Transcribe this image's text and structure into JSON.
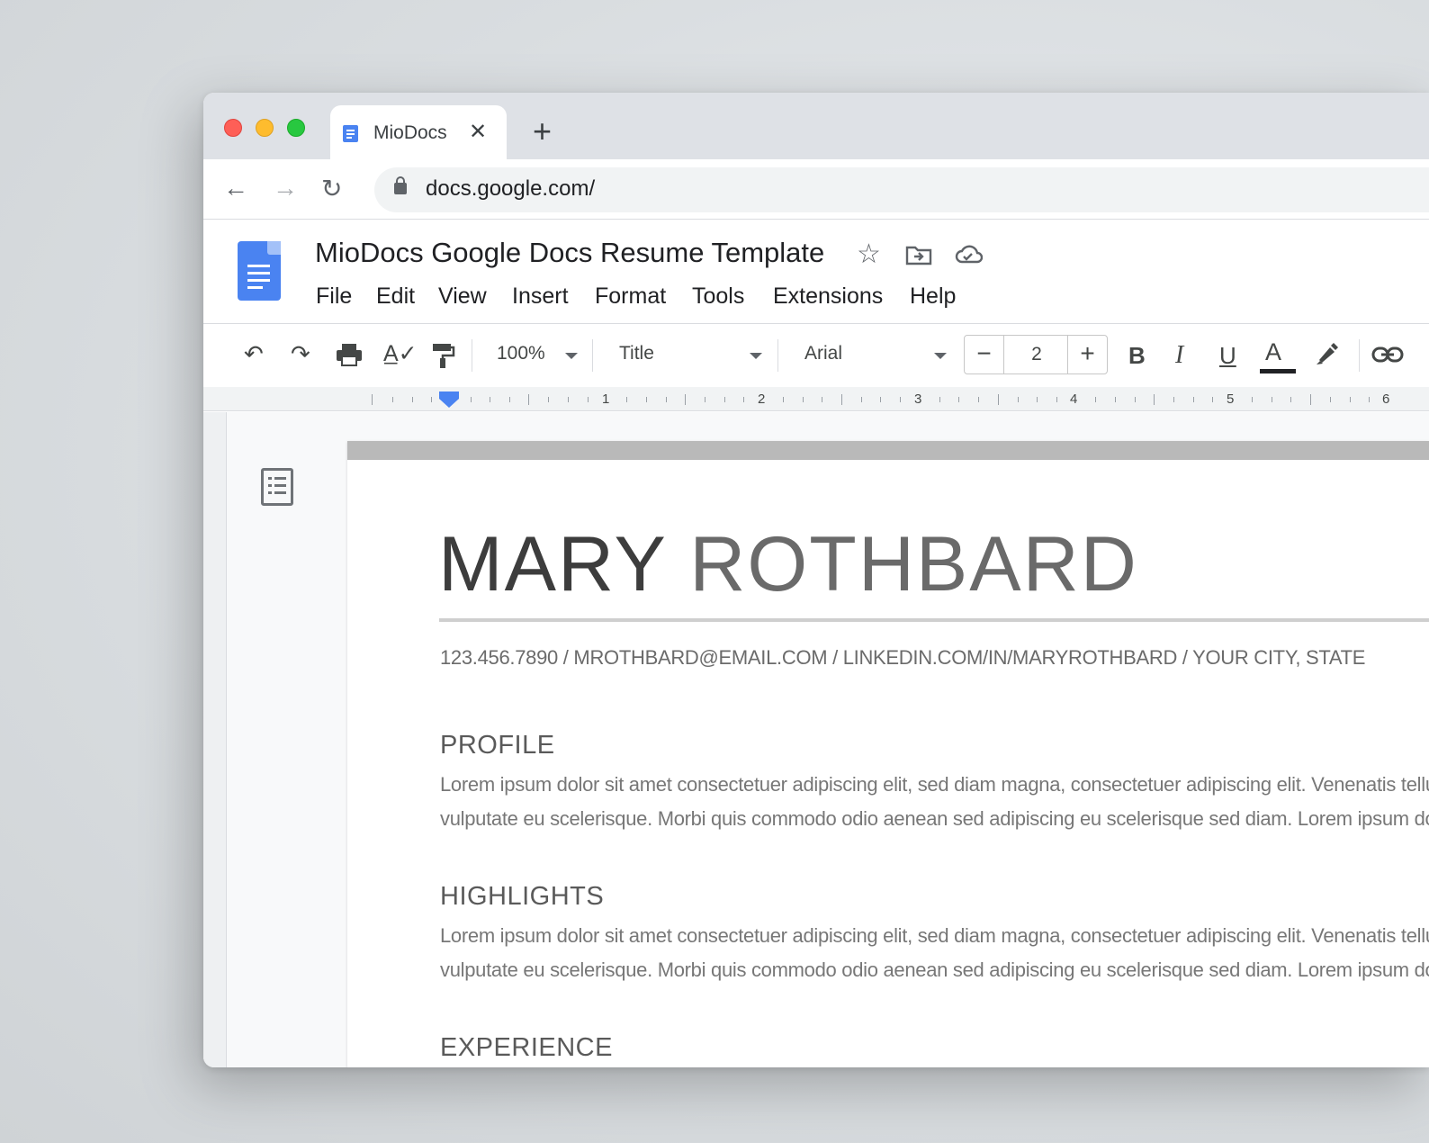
{
  "browser": {
    "tab_title": "MioDocs",
    "new_tab_label": "+",
    "url": "docs.google.com/"
  },
  "docs": {
    "title": "MioDocs Google Docs Resume Template",
    "menu": [
      "File",
      "Edit",
      "View",
      "Insert",
      "Format",
      "Tools",
      "Extensions",
      "Help"
    ],
    "toolbar": {
      "zoom": "100%",
      "style": "Title",
      "font": "Arial",
      "font_size": "2",
      "bold_label": "B",
      "italic_label": "I",
      "underline_label": "U",
      "text_color_label": "A",
      "text_color": "#202124"
    },
    "ruler_numbers": [
      "1",
      "2",
      "3",
      "4",
      "5",
      "6"
    ]
  },
  "resume": {
    "first_name": "MARY",
    "last_name": "ROTHBARD",
    "contact": "123.456.7890  /  MROTHBARD@EMAIL.COM  /  LINKEDIN.COM/IN/MARYROTHBARD  /  YOUR CITY, STATE",
    "sections": [
      {
        "heading": "PROFILE",
        "lines": [
          "Lorem ipsum dolor sit amet consectetuer adipiscing elit, sed diam magna, consectetuer adipiscing elit. Venenatis tellus",
          "vulputate eu scelerisque. Morbi quis commodo odio aenean sed adipiscing eu scelerisque sed diam. Lorem ipsum dolo"
        ]
      },
      {
        "heading": "HIGHLIGHTS",
        "lines": [
          "Lorem ipsum dolor sit amet consectetuer adipiscing elit, sed diam magna, consectetuer adipiscing elit. Venenatis tellus",
          "vulputate eu scelerisque. Morbi quis commodo odio aenean sed adipiscing eu scelerisque sed diam. Lorem ipsum dolo"
        ]
      },
      {
        "heading": "EXPERIENCE",
        "lines": []
      }
    ]
  },
  "colors": {
    "docs_blue": "#4a83f1",
    "traffic_red": "#fe5f57",
    "traffic_yellow": "#febc2e",
    "traffic_green": "#28c840"
  }
}
